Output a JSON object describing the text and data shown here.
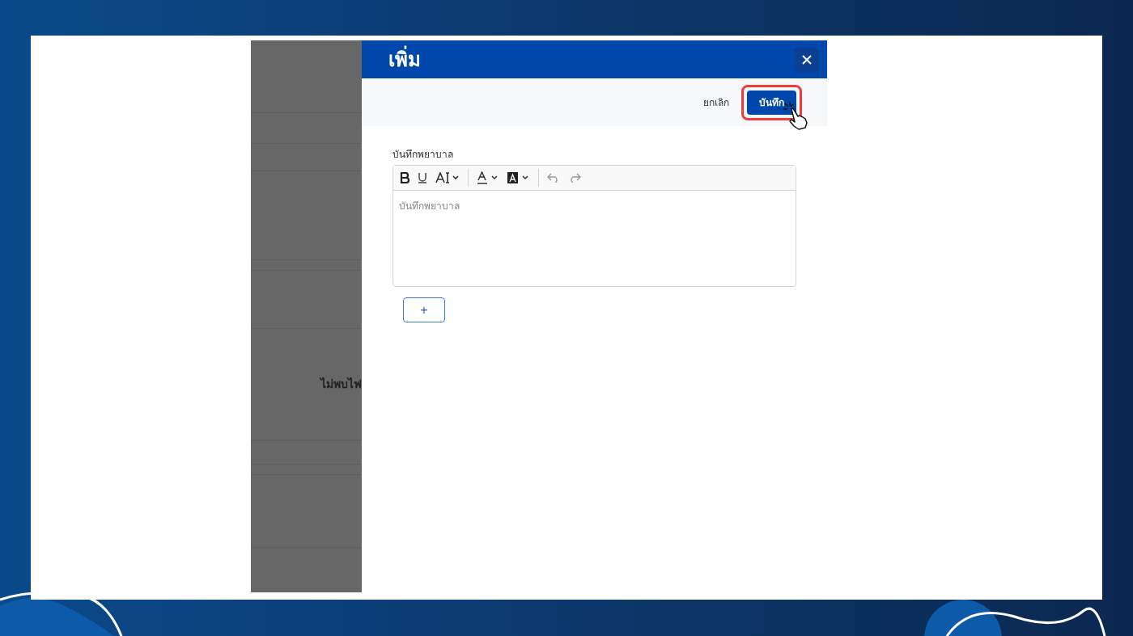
{
  "background_page": {
    "empty_message": "ไม่พบไฟ"
  },
  "dialog": {
    "title": "เพิ่ม",
    "actions": [
      {
        "label": "ยกเลิก",
        "kind": "text"
      },
      {
        "label": "บันทึก",
        "kind": "primary",
        "highlighted": true
      }
    ],
    "field": {
      "label": "บันทึกพยาบาล",
      "placeholder": "บันทึกพยาบาล"
    },
    "add_button": "+"
  }
}
